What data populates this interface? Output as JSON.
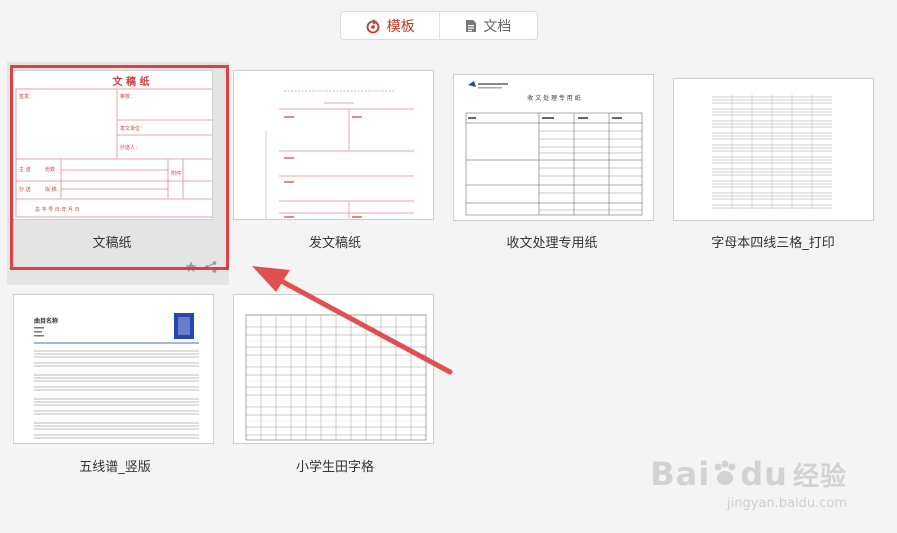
{
  "toolbar": {
    "template_label": "模板",
    "document_label": "文档"
  },
  "accent": "#c0392b",
  "templates": [
    {
      "name": "文稿纸",
      "preview": {
        "title": "文 稿 纸",
        "fields": [
          "签发：",
          "审核：",
          "发文单位：",
          "抄送人：",
          "主 送",
          "抄 送",
          "附件",
          "份数",
          "拟 稿"
        ],
        "footer": "总    字    号    日 年 月 日"
      }
    },
    {
      "name": "发文稿纸"
    },
    {
      "name": "收文处理专用纸",
      "preview": {
        "title": "收 文 处 理 专 用 纸"
      }
    },
    {
      "name": "字母本四线三格_打印"
    },
    {
      "name": "五线谱_竖版",
      "preview": {
        "title": "曲目名称"
      }
    },
    {
      "name": "小学生田字格"
    }
  ],
  "watermark": {
    "brand": "Bai",
    "brand2": "du",
    "cn": "经验",
    "url": "jingyan.baidu.com"
  }
}
